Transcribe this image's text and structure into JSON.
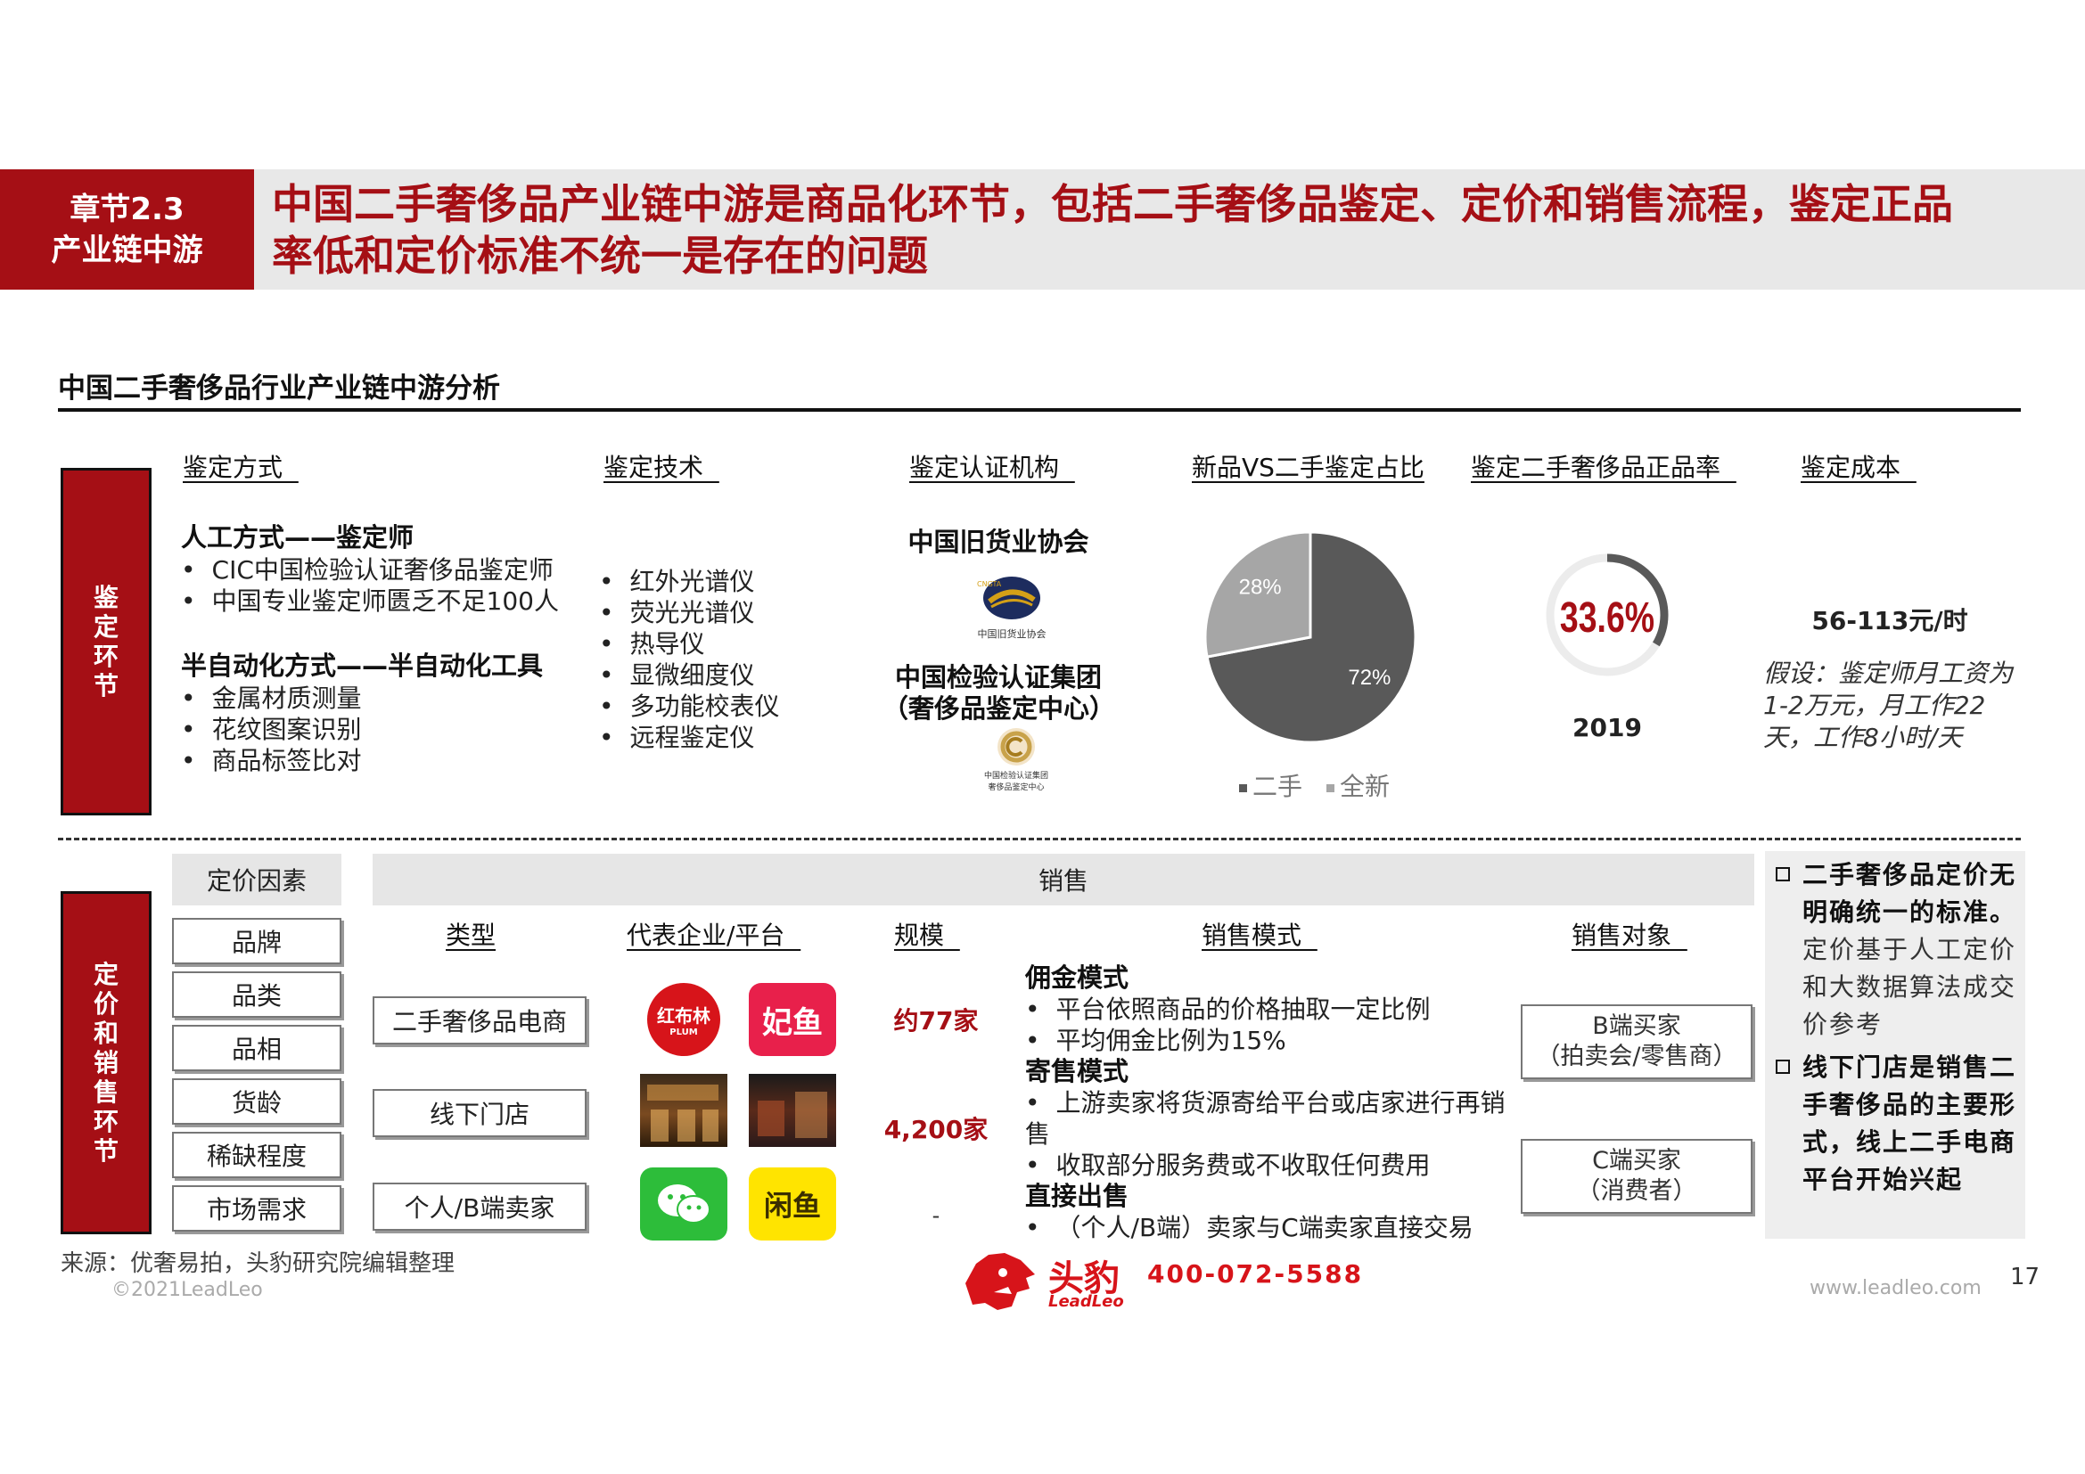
{
  "header": {
    "chapter": "章节2.3",
    "chapter_sub": "产业链中游",
    "title_line1": "中国二手奢侈品产业链中游是商品化环节，包括二手奢侈品鉴定、定价和销售流程，鉴定正品",
    "title_line2": "率低和定价标准不统一是存在的问题"
  },
  "section_title": "中国二手奢侈品行业产业链中游分析",
  "appraisal": {
    "side_label": [
      "鉴",
      "定",
      "环",
      "节"
    ],
    "col_method": "鉴定方式  ",
    "col_tech": "鉴定技术  ",
    "col_org": "鉴定认证机构  ",
    "col_ratio": "新品VS二手鉴定占比",
    "col_rate": "鉴定二手奢侈品正品率  ",
    "col_cost": "鉴定成本  ",
    "manual_title": "人工方式——鉴定师",
    "manual_items": [
      "CIC中国检验认证奢侈品鉴定师",
      "中国专业鉴定师匮乏不足100人"
    ],
    "semi_title": "半自动化方式——半自动化工具",
    "semi_items": [
      "金属材质测量",
      "花纹图案识别",
      "商品标签比对"
    ],
    "tech_items": [
      "红外光谱仪",
      "荧光光谱仪",
      "热导仪",
      "显微细度仪",
      "多功能校表仪",
      "远程鉴定仪"
    ],
    "org1": "中国旧货业协会",
    "org1_logo_text": "中国旧货业协会",
    "org1_logo_abbr": "CNGTA",
    "org2_line1": "中国检验认证集团",
    "org2_line2": "（奢侈品鉴定中心）",
    "org2_logo_line1": "中国检验认证集团",
    "org2_logo_line2": "奢侈品鉴定中心",
    "rate_value": "33.6%",
    "rate_year": "2019",
    "cost_value": "56-113元/时",
    "cost_note": "假设：鉴定师月工资为1-2万元，月工作22天，工作8小时/天"
  },
  "chart_data": {
    "type": "pie",
    "title": "",
    "categories": [
      "二手",
      "全新"
    ],
    "values": [
      72,
      28
    ],
    "labels": [
      "72%",
      "28%"
    ],
    "colors": [
      "#595959",
      "#a6a6a6"
    ],
    "legend": "bottom"
  },
  "rate_ring": {
    "fraction": 0.336,
    "color": "#595959"
  },
  "pricing": {
    "side_label": [
      "定",
      "价",
      "和",
      "销",
      "售",
      "环",
      "节"
    ],
    "factor_head": "定价因素",
    "factors": [
      "品牌",
      "品类",
      "品相",
      "货龄",
      "稀缺程度",
      "市场需求"
    ],
    "sales_head": "销售",
    "col_type": "类型",
    "col_company": "代表企业/平台  ",
    "col_scale": "规模  ",
    "col_mode": "销售模式  ",
    "col_target": "销售对象  ",
    "types": [
      "二手奢侈品电商",
      "线下门店",
      "个人/B端卖家"
    ],
    "logos": {
      "hongbulin": "红布林",
      "hongbulin_sub": "PLUM",
      "feiyu": "妃鱼",
      "xianyu": "闲鱼"
    },
    "scales": [
      "约77家",
      "4,200家",
      "-"
    ],
    "mode_commission_title": "佣金模式",
    "mode_commission_items": [
      "平台依照商品的价格抽取一定比例",
      "平均佣金比例为15%"
    ],
    "mode_consign_title": "寄售模式",
    "mode_consign_items": [
      "上游卖家将货源寄给平台或店家进行再销售",
      "收取部分服务费或不收取任何费用"
    ],
    "mode_direct_title": "直接出售",
    "mode_direct_items": [
      "（个人/B端）卖家与C端卖家直接交易"
    ],
    "buyer_b_line1": "B端买家",
    "buyer_b_line2": "（拍卖会/零售商）",
    "buyer_c_line1": "C端买家",
    "buyer_c_line2": "（消费者）"
  },
  "notes": {
    "note1_bold": "二手奢侈品定价无明确统一的标准。",
    "note1_rest": "定价基于人工定价和大数据算法成交价参考",
    "note2_bold": "线下门店是销售二手奢侈品的主要形式，线上二手电商平台开始兴起"
  },
  "footer": {
    "source": "来源：优奢易拍，头豹研究院编辑整理",
    "copyright": "©2021LeadLeo",
    "brand": "头豹",
    "brand_en": "LeadLeo",
    "phone": "400-072-5588",
    "website": "www.leadleo.com",
    "page": "17"
  }
}
